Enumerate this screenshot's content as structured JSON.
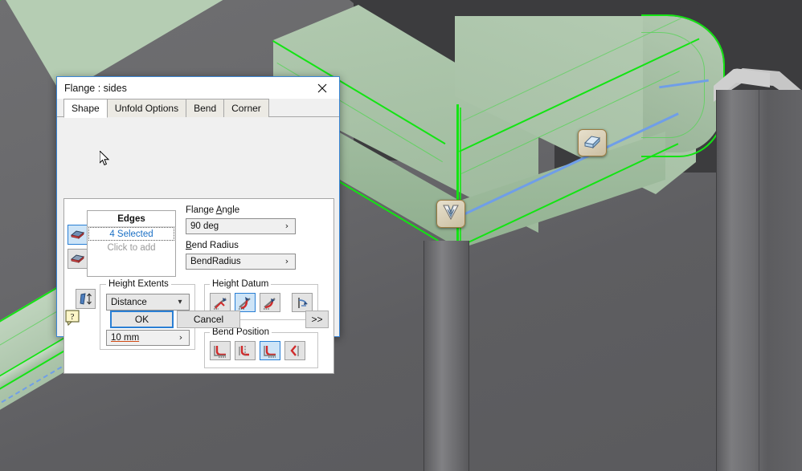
{
  "dialog": {
    "title": "Flange : sides",
    "close_icon": "close-icon",
    "tabs": [
      {
        "label": "Shape",
        "active": true
      },
      {
        "label": "Unfold Options",
        "active": false
      },
      {
        "label": "Bend",
        "active": false
      },
      {
        "label": "Corner",
        "active": false
      }
    ],
    "edges": {
      "header": "Edges",
      "selected_text": "4 Selected",
      "add_text": "Click to add",
      "mode_buttons": [
        {
          "name": "edge-select-mode-button",
          "selected": true
        },
        {
          "name": "face-select-mode-button",
          "selected": false
        }
      ]
    },
    "flange_angle": {
      "label": "Flange Angle",
      "accel": "A",
      "value": "90 deg"
    },
    "bend_radius": {
      "label": "Bend Radius",
      "accel": "B",
      "value": "BendRadius"
    },
    "height_extents": {
      "label": "Height Extents",
      "type_value": "Distance",
      "distance_value": "10 mm",
      "flip_button": "flip-height-direction-button"
    },
    "height_datum": {
      "label": "Height Datum",
      "buttons": [
        {
          "name": "height-datum-outer-button",
          "selected": false
        },
        {
          "name": "height-datum-inner-button",
          "selected": true
        },
        {
          "name": "height-datum-tangent-button",
          "selected": false
        },
        {
          "name": "height-datum-measure-button",
          "selected": false
        }
      ]
    },
    "bend_position": {
      "label": "Bend Position",
      "buttons": [
        {
          "name": "bend-position-inside-button",
          "selected": false
        },
        {
          "name": "bend-position-outside-button",
          "selected": false
        },
        {
          "name": "bend-position-tangent-button",
          "selected": true
        },
        {
          "name": "bend-position-adjacent-button",
          "selected": false
        }
      ]
    },
    "footer": {
      "help_label": "?",
      "ok_label": "OK",
      "cancel_label": "Cancel",
      "expand_label": ">>"
    }
  },
  "viewport": {
    "badges": [
      {
        "name": "flange-direction-handle",
        "icon": "flange-glyph-icon"
      },
      {
        "name": "bend-direction-handle",
        "icon": "sheet-metal-glyph-icon"
      }
    ]
  },
  "colors": {
    "accent": "#2a7fd4",
    "selected_edge": "#13e413",
    "selected_face": "#a9c3a8",
    "highlight_line": "#6f9ee8",
    "background": "#68686b",
    "link_text": "#1a6fc4"
  }
}
